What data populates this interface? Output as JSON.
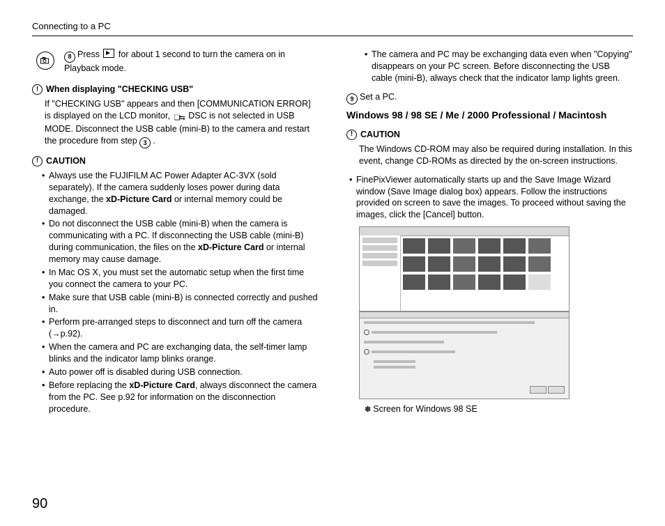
{
  "runHead": "Connecting to a PC",
  "pageNumber": "90",
  "step8": {
    "num": "8",
    "text1": "Press ",
    "text2": " for about 1 second to turn the camera on in Playback mode."
  },
  "checkUsb": {
    "title": "When displaying \"CHECKING USB\"",
    "body1": "If \"CHECKING USB\" appears and then [COMMUNICATION ERROR] is displayed on the LCD monitor, ",
    "body2": " DSC is not selected in USB MODE. Disconnect the USB cable (mini-B) to the camera and restart the procedure from step ",
    "restartStep": "3",
    "body3": "."
  },
  "caution1": {
    "title": "CAUTION",
    "items": [
      {
        "pre": "Always use the FUJIFILM AC Power Adapter AC-3VX (sold separately). If the camera suddenly loses power during data exchange, the ",
        "b": "xD-Picture Card",
        "post": " or internal memory could be damaged."
      },
      {
        "pre": "Do not disconnect the USB cable (mini-B) when the camera is communicating with a PC. If disconnecting the USB cable (mini-B) during communication, the files on the ",
        "b": "xD-Picture Card",
        "post": " or internal memory may cause damage."
      },
      {
        "pre": "In Mac OS X, you must set the automatic setup when the first time you connect the camera to your PC.",
        "b": "",
        "post": ""
      },
      {
        "pre": "Make sure that USB cable (mini-B) is connected correctly and pushed in.",
        "b": "",
        "post": ""
      },
      {
        "pre": "Perform pre-arranged steps to disconnect and turn off the camera (→p.92).",
        "b": "",
        "post": ""
      },
      {
        "pre": "When the camera and PC are exchanging data, the self-timer lamp blinks and the indicator lamp blinks orange.",
        "b": "",
        "post": ""
      },
      {
        "pre": "Auto power off is disabled during USB connection.",
        "b": "",
        "post": ""
      },
      {
        "pre": "Before replacing the ",
        "b": "xD-Picture Card",
        "post": ", always disconnect the camera from the PC. See p.92 for information on the disconnection procedure."
      }
    ]
  },
  "rightTop": {
    "bullet": "The camera and PC may be exchanging data even when \"Copying\" disappears on your PC screen. Before disconnecting the USB cable (mini-B), always check that the indicator lamp lights green."
  },
  "step9": {
    "num": "9",
    "text": "Set a PC."
  },
  "osHead": "Windows 98 / 98 SE / Me / 2000 Professional / Macintosh",
  "caution2": {
    "title": "CAUTION",
    "body": "The Windows CD-ROM may also be required during installation. In this event, change CD-ROMs as directed by the on-screen instructions."
  },
  "fpv": "FinePixViewer automatically starts up and the Save Image Wizard window (Save Image dialog box) appears. Follow the instructions provided on screen to save the images. To proceed without saving the images, click the [Cancel] button.",
  "shotCaption": "Screen for Windows 98 SE"
}
